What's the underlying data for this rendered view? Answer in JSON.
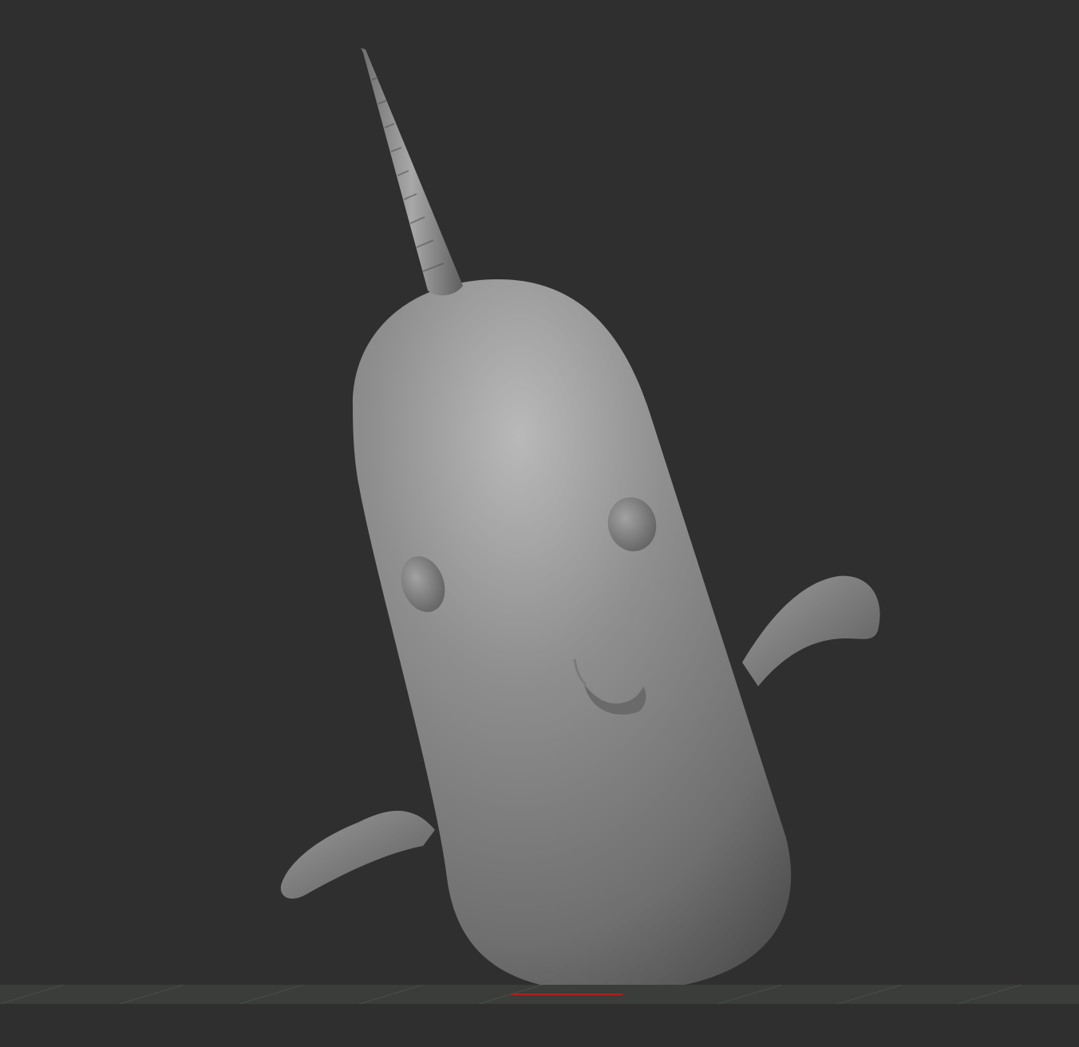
{
  "app": {
    "view": "3d-viewport",
    "background_color": "#2f2f2f"
  },
  "model": {
    "subject": "narwhal",
    "material_color": "#8a8a8a",
    "icons": [
      "narwhal-model"
    ]
  },
  "floor": {
    "grid_color": "#3a3d3a",
    "axis_marker_color": "#b02020"
  }
}
